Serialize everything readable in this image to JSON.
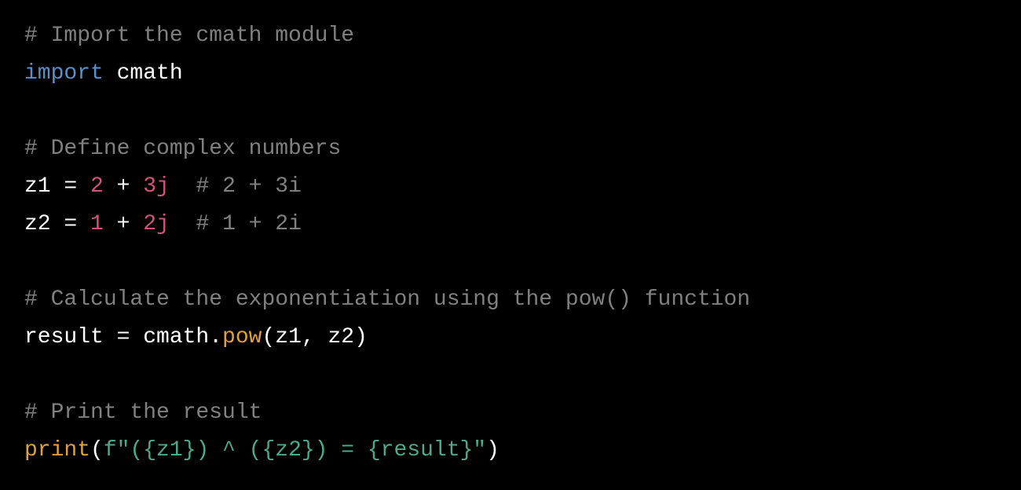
{
  "code": {
    "language": "python",
    "colors": {
      "background": "#000000",
      "comment": "#808080",
      "keyword": "#5b8fc7",
      "plain": "#ffffff",
      "number": "#d1527a",
      "function": "#e0a040",
      "string": "#4fa88a"
    },
    "lines": [
      {
        "tokens": [
          {
            "type": "comment",
            "text": "# Import the cmath module"
          }
        ]
      },
      {
        "tokens": [
          {
            "type": "keyword",
            "text": "import"
          },
          {
            "type": "plain",
            "text": " cmath"
          }
        ]
      },
      {
        "tokens": []
      },
      {
        "tokens": [
          {
            "type": "comment",
            "text": "# Define complex numbers"
          }
        ]
      },
      {
        "tokens": [
          {
            "type": "plain",
            "text": "z1 = "
          },
          {
            "type": "number",
            "text": "2"
          },
          {
            "type": "plain",
            "text": " + "
          },
          {
            "type": "number",
            "text": "3j"
          },
          {
            "type": "plain",
            "text": "  "
          },
          {
            "type": "comment",
            "text": "# 2 + 3i"
          }
        ]
      },
      {
        "tokens": [
          {
            "type": "plain",
            "text": "z2 = "
          },
          {
            "type": "number",
            "text": "1"
          },
          {
            "type": "plain",
            "text": " + "
          },
          {
            "type": "number",
            "text": "2j"
          },
          {
            "type": "plain",
            "text": "  "
          },
          {
            "type": "comment",
            "text": "# 1 + 2i"
          }
        ]
      },
      {
        "tokens": []
      },
      {
        "tokens": [
          {
            "type": "comment",
            "text": "# Calculate the exponentiation using the pow() function"
          }
        ]
      },
      {
        "tokens": [
          {
            "type": "plain",
            "text": "result = cmath."
          },
          {
            "type": "func",
            "text": "pow"
          },
          {
            "type": "plain",
            "text": "(z1, z2)"
          }
        ]
      },
      {
        "tokens": []
      },
      {
        "tokens": [
          {
            "type": "comment",
            "text": "# Print the result"
          }
        ]
      },
      {
        "tokens": [
          {
            "type": "func",
            "text": "print"
          },
          {
            "type": "plain",
            "text": "("
          },
          {
            "type": "string",
            "text": "f\"({z1}) ^ ({z2}) = {result}\""
          },
          {
            "type": "plain",
            "text": ")"
          }
        ]
      }
    ]
  }
}
